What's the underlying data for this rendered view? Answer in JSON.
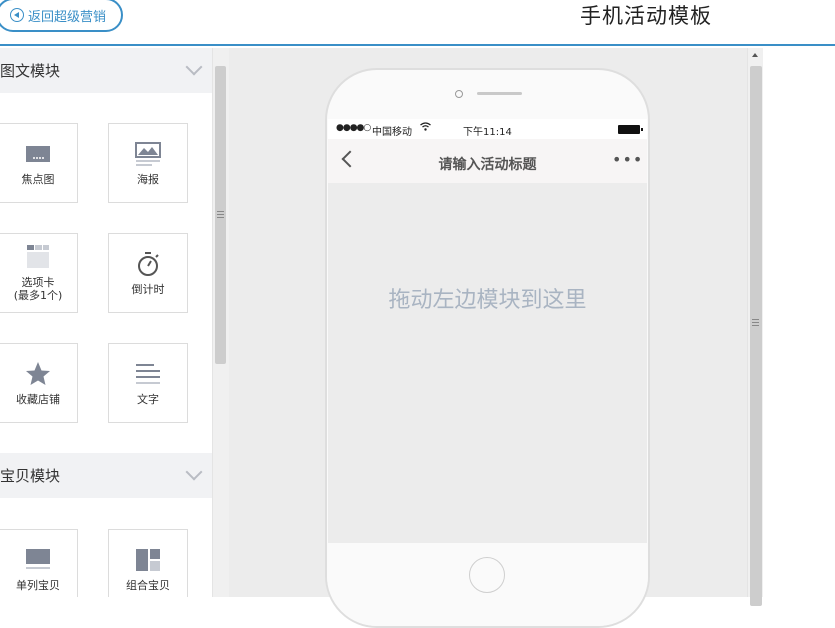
{
  "header": {
    "back_label": "返回超级营销",
    "page_title": "手机活动模板"
  },
  "sections": [
    {
      "title": "图文模块",
      "modules": [
        {
          "label": "焦点图",
          "icon": "focus-image-icon"
        },
        {
          "label": "海报",
          "icon": "poster-icon"
        },
        {
          "label": "选项卡\n(最多1个)",
          "icon": "tabs-icon"
        },
        {
          "label": "倒计时",
          "icon": "countdown-timer-icon"
        },
        {
          "label": "收藏店铺",
          "icon": "star-icon"
        },
        {
          "label": "文字",
          "icon": "text-lines-icon"
        }
      ]
    },
    {
      "title": "宝贝模块",
      "modules": [
        {
          "label": "单列宝贝",
          "icon": "single-item-icon"
        },
        {
          "label": "组合宝贝",
          "icon": "combo-item-icon"
        }
      ]
    }
  ],
  "phone": {
    "status": {
      "signal": "●●●●○",
      "carrier": "中国移动",
      "time": "下午11:14"
    },
    "nav_title": "请输入活动标题",
    "more": "•••",
    "drop_hint": "拖动左边模块到这里"
  },
  "colors": {
    "accent": "#3a8fc7",
    "icon_gray": "#7e8594",
    "hint": "#a9b4c2"
  }
}
